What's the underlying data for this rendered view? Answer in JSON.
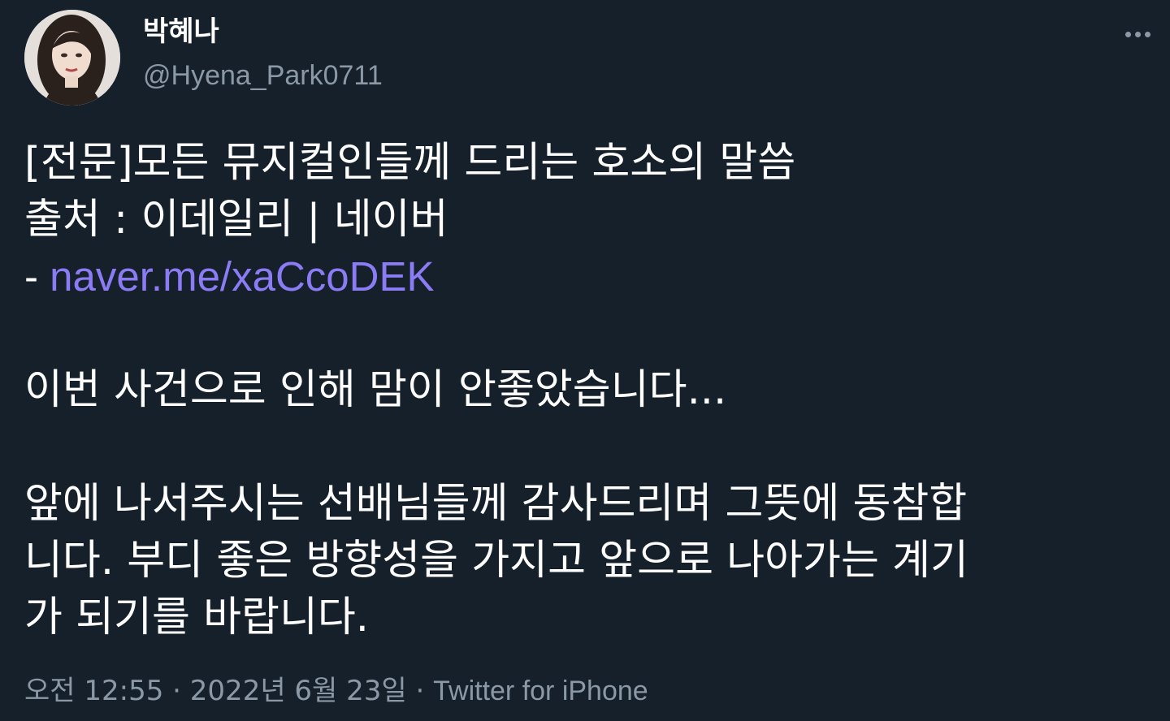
{
  "author": {
    "display_name": "박혜나",
    "handle": "@Hyena_Park0711"
  },
  "tweet": {
    "lines_a": [
      "[전문]모든 뮤지컬인들께 드리는 호소의 말씀",
      "출처 : 이데일리 | 네이버"
    ],
    "link_prefix": " - ",
    "link_text": "naver.me/xaCcoDEK",
    "paragraph_2": "이번 사건으로 인해 맘이 안좋았습니다...",
    "lines_c": [
      "앞에 나서주시는 선배님들께 감사드리며 그뜻에 동참합",
      "니다. 부디 좋은 방향성을 가지고 앞으로 나아가는 계기",
      "가 되기를 바랍니다."
    ]
  },
  "meta": {
    "time": "오전 12:55",
    "separator": " · ",
    "date": "2022년 6월 23일",
    "source": "Twitter for iPhone"
  },
  "colors": {
    "background": "#15202b",
    "text": "#ffffff",
    "secondary": "#8b98a5",
    "link": "#8b7cf6"
  },
  "icons": {
    "more": "more-horizontal-icon"
  }
}
